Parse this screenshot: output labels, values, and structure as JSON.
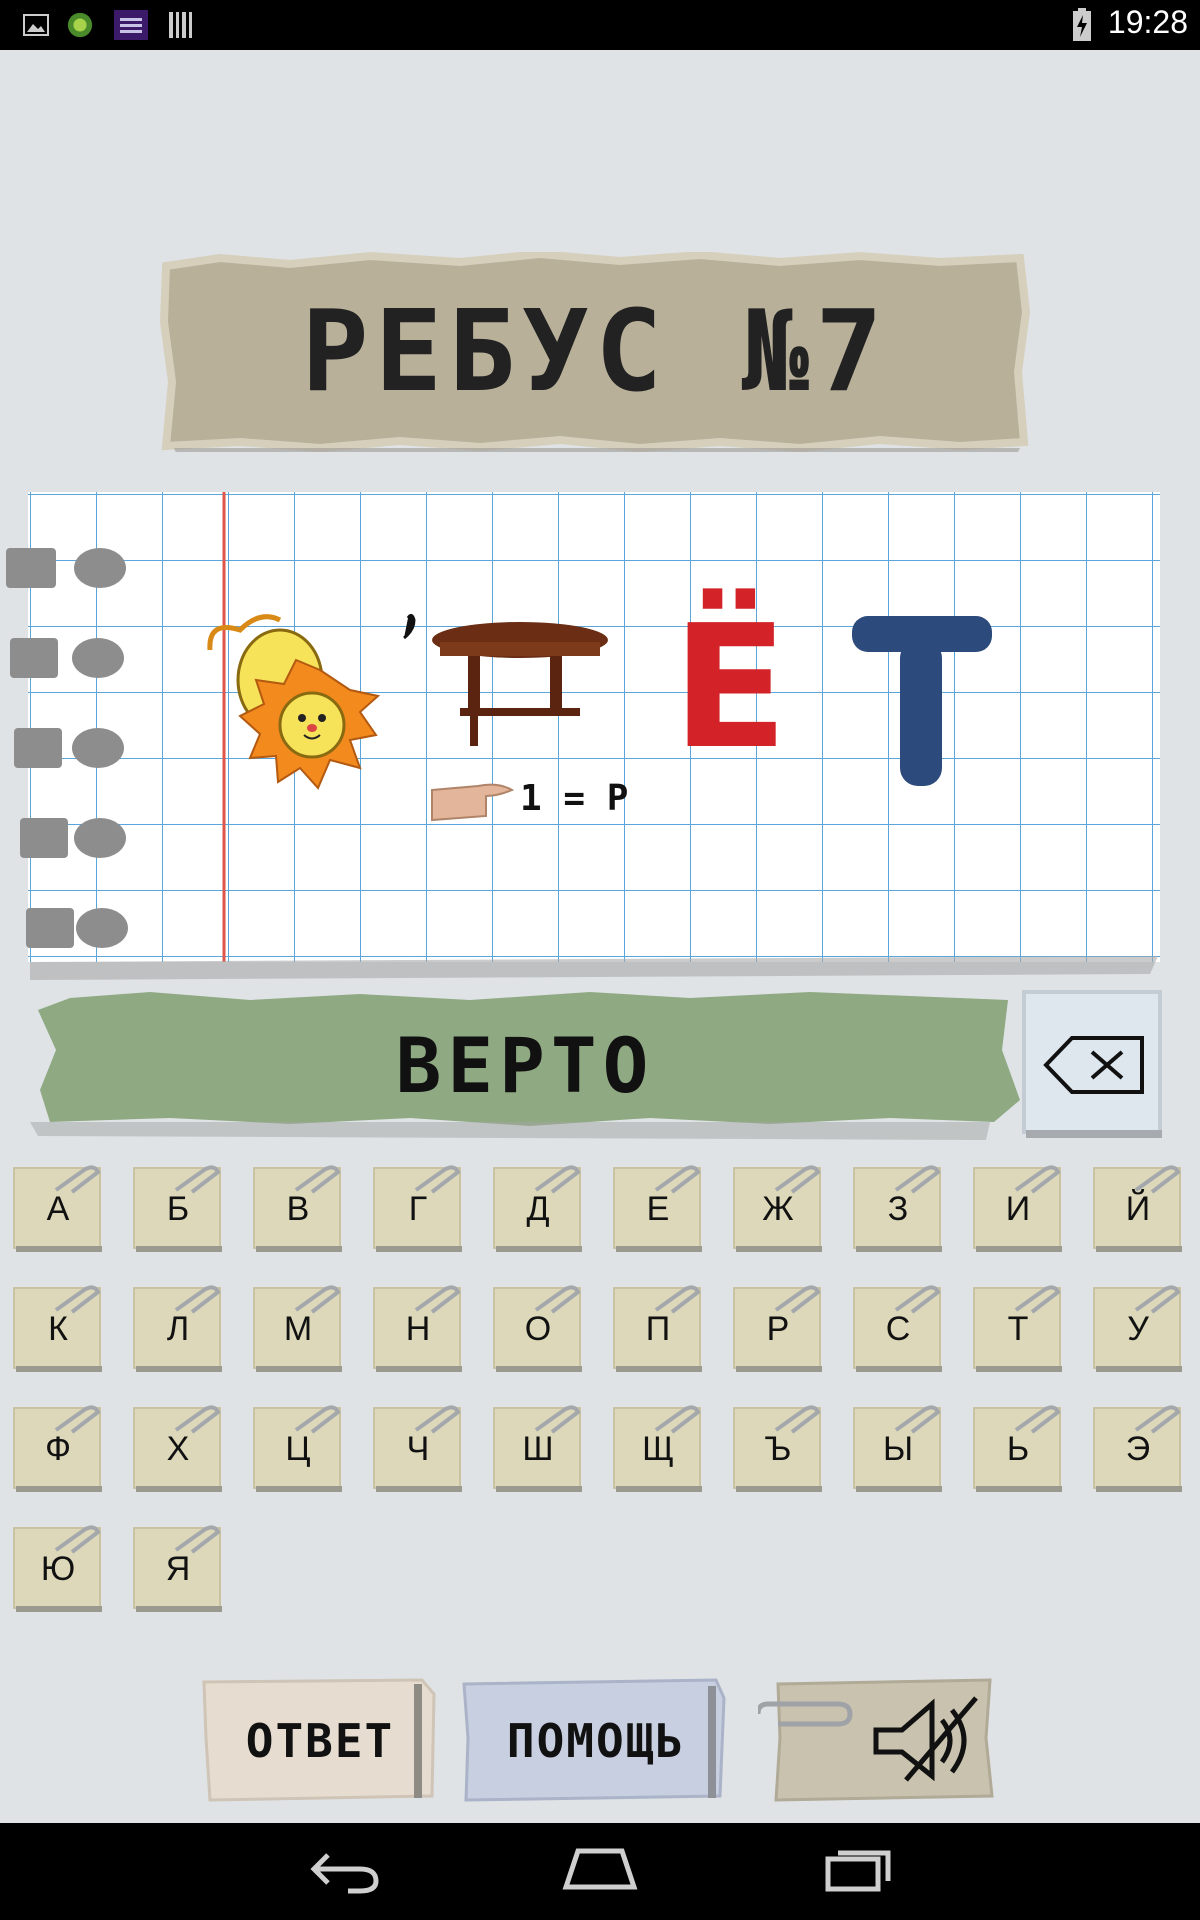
{
  "status_bar": {
    "time": "19:28",
    "icons": [
      "gallery-icon",
      "game-icon",
      "app-icon",
      "barcode-icon",
      "battery-charging-icon"
    ]
  },
  "title": "РЕБУС №7",
  "puzzle": {
    "images": [
      "lion-icon",
      "table-icon",
      "letter-yo-icon",
      "letter-t-icon",
      "pointing-hand-icon"
    ],
    "hint_text": "1 = Р",
    "letter_yo": "Ё",
    "letter_t": "T"
  },
  "answer": {
    "value": "ВЕРТО"
  },
  "keyboard": {
    "keys": [
      "А",
      "Б",
      "В",
      "Г",
      "Д",
      "Е",
      "Ж",
      "З",
      "И",
      "Й",
      "К",
      "Л",
      "М",
      "Н",
      "О",
      "П",
      "Р",
      "С",
      "Т",
      "У",
      "Ф",
      "Х",
      "Ц",
      "Ч",
      "Ш",
      "Щ",
      "Ъ",
      "Ы",
      "Ь",
      "Э",
      "Ю",
      "Я"
    ]
  },
  "buttons": {
    "answer_label": "ОТВЕТ",
    "help_label": "ПОМОЩЬ",
    "sound_icon": "speaker-muted-icon"
  },
  "nav": [
    "back-icon",
    "home-icon",
    "recents-icon"
  ]
}
